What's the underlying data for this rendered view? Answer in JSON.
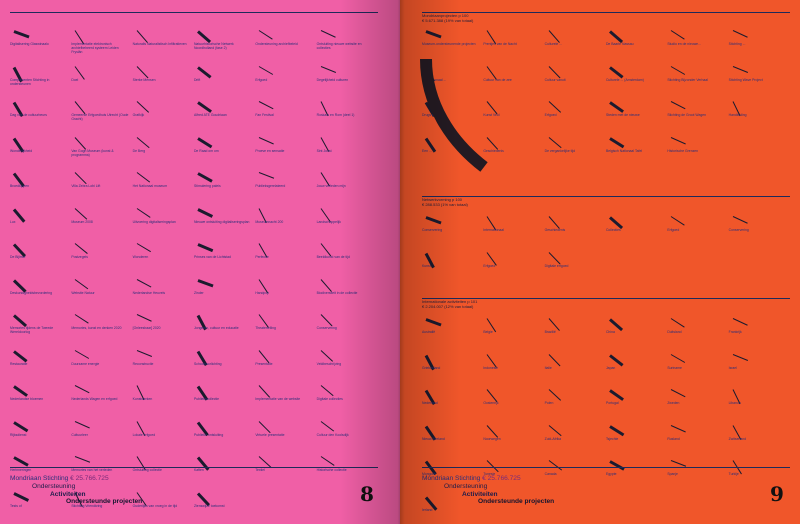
{
  "colors": {
    "left_page": "#f05fa6",
    "right_page": "#f0562a",
    "ink": "#1b1b2e",
    "label": "#2b2f7a"
  },
  "left_page": {
    "page_number": "8",
    "footer": {
      "org": "Mondriaan Stichting",
      "amount": "€ 25.766.725",
      "line2": "Ondersteuning",
      "line3": "Activiteiten",
      "line4": "Ondersteunde projecten"
    },
    "cells": [
      "Digitalisering Glaswinaalo",
      "Implementatie elektronisch archiefbeheerd systeem Leiden Fryslân",
      "Naturalis Naturalistisch Infiltratieven",
      "Natuurhistorische Netwerk Noordholland (fase 2)",
      "Ondersteuning archiefbeleid",
      "Ontsluiting nieuwe website en collecties",
      "Complimenten Stichting in ondersteunen",
      "Doel",
      "Sterke Mensen",
      "Drift",
      "Erfgoed",
      "Degelijkheid culturen",
      "Dag van de cultuurbeurs",
      "Gemeente Erfgoedhuis Utrecht (Oude Gracht)",
      "Grafkijk",
      "Alfred ATE Goudriaan",
      "Fan Festival",
      "Roskam en Rom (deel 1)",
      "Wonderlijkheid",
      "Van Gogh Museum (kunst & programma)",
      "De Berg",
      "De Raad om om",
      "Proeve en sensatie",
      "Sint Joost",
      "Broedkippen",
      "Villa Zebra Lobi Lift",
      "Het Nationaal museum",
      "Stimulering paleis",
      "Publieksgerelateerd",
      "Jouw verleden mijn",
      "Lux",
      "Museum 2008",
      "Uitvoering digitaliseringsplan",
      "Nieuwe ontsluiting digitaliseringsplan",
      "Museumnacht 200",
      "Landschappelijk",
      "De Bijlmer",
      "Postzegels",
      "Wonderen",
      "Prinses van de Lichtstad",
      "Perfectie",
      "Beeldkunst van de tijd",
      "Deskundigheidsbevordering",
      "Website Natuur",
      "Nederlandse Heuvels",
      "Zinder",
      "Handpop",
      "Biodiversiteit in de collectie",
      "Memories tijdens de Tweede Wereldoorlog",
      "Memories, kunst en denken 2020",
      "[Onleesbaar] 2020",
      "Jongeren, cultuur en educatie",
      "Theatertelling",
      "Conservering",
      "Restauratie",
      "Duurzame energie",
      "Reconstructie",
      "Schoolvoorlichting",
      "Presentatie",
      "Veldbeschrijving",
      "Nederlandse bloemen",
      "Nederlands Wagen en erfgoed",
      "Kunstwerken",
      "Publiekscollectie",
      "Implementatie van de website",
      "Digitale collecties",
      "Rijksdienst",
      "Cultuurleer",
      "Lokale erfgoed",
      "Publieke ontsluiting",
      "Virtuele presentatie",
      "Cultuur den Koolsdijk",
      "Herinneringen",
      "Memories van het verleden",
      "Ontsluiting collectie",
      "Kaften",
      "Textiel",
      "Historische collectie",
      "Tests of",
      "Stichting Vriendkring",
      "Ouderlijks van vroeg in de tijd",
      "Zienswijze toekomst"
    ]
  },
  "right_page": {
    "page_number": "9",
    "footer": {
      "org": "Mondriaan Stichting",
      "amount": "€ 25.766.725",
      "line2": "Ondersteuning",
      "line3": "Activiteiten",
      "line4": "Ondersteunde projecten"
    },
    "section1": {
      "title": "Mondriaanprojecten p 100\n€ 5.671.388 (19% van totaal)",
      "cells": [
        "Museum-ondersteunende projecten",
        "Prentjes van de Nacht",
        "Culturele ...",
        "De Baarle Nassau",
        "Studio en de nieuwe...",
        "Stichting ...",
        "Het Nationaal ...",
        "Cultuur van de zee",
        "Cultuur vanuit",
        "Culturele ... (Amsterdam)",
        "Stichting Bijzonder Verhaal",
        "Stichting Wave Project",
        "Drugs en film",
        "Kunst Veld",
        "Erfgoed",
        "Steden met de nieuwe",
        "Stichting de Groot Wagen",
        "Handleiding",
        "Een ...",
        "Geschiedenis",
        "De vergankelijke tijd",
        "Belgisch Nationaal Tafel",
        "Historische Grenzen"
      ]
    },
    "section2": {
      "title": "Netwerkvorming p 100\n€ 288.533 (1% van totaal)",
      "cells": [
        "Conservering",
        "Internationaal",
        "Geschiedenis",
        "Collecties",
        "Erfgoed",
        "Conservering",
        "Kunst",
        "Erfgoed",
        "Digitale erfgoed"
      ]
    },
    "section3": {
      "title": "Internationale activiteiten p 101\n€ 2.204.007 (12% van totaal)",
      "cells": [
        "Australië",
        "Belgie",
        "Brazilië",
        "China",
        "Duitsland",
        "Frankrijk",
        "Griekenland",
        "Indonesie",
        "Italie",
        "Japan",
        "Suriname",
        "Israel",
        "Nederland",
        "Oostenrijk",
        "Polen",
        "Portugal",
        "Zweden",
        "Libanon",
        "Nieuw-Zeeland",
        "Noorwegen",
        "Zuid-Afrika",
        "Tsjechie",
        "Rusland",
        "Zwitserland",
        "Mongolië",
        "Tunesie",
        "Canada",
        "Egypte",
        "Spanje",
        "Turkije",
        "Ierland"
      ]
    }
  }
}
